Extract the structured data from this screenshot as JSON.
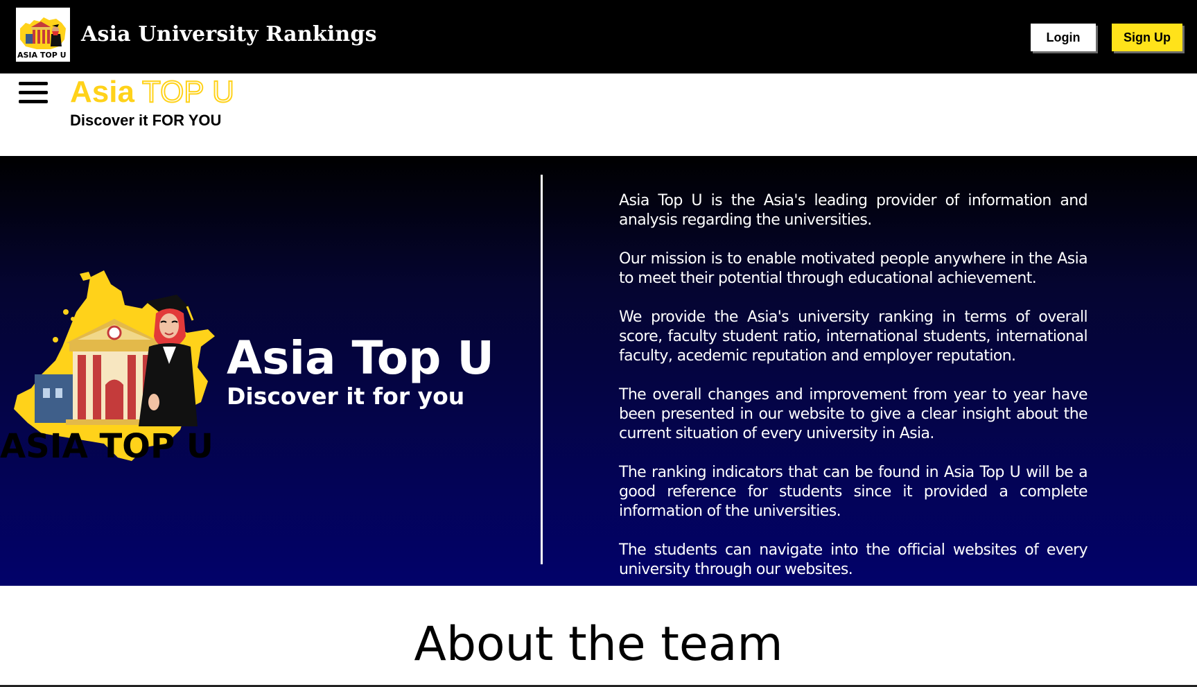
{
  "header": {
    "logo_text": "ASIA TOP U",
    "site_title": "Asia University Rankings",
    "login_label": "Login",
    "signup_label": "Sign Up"
  },
  "brand": {
    "asia": "Asia",
    "top_u": "TOP U",
    "tagline": "Discover it FOR YOU"
  },
  "hero": {
    "logo_text": "ASIA TOP U",
    "title": "Asia Top U",
    "subtitle": "Discover it for you",
    "paragraphs": [
      "Asia Top U is the Asia's leading provider of information and analysis regarding the universities.",
      "Our mission is to enable motivated people anywhere in the Asia to meet their potential through educational achievement.",
      "We provide the Asia's university ranking in terms of overall score, faculty student ratio, international students, international faculty, acedemic reputation and employer reputation.",
      "The overall changes and improvement from year to year have been presented in our website to give a clear insight about the current situation of every university in Asia.",
      "The ranking indicators that can be found in Asia Top U will be a good reference for students since it provided a complete information of the universities.",
      "The students can navigate into the official websites of every university through our websites."
    ]
  },
  "team": {
    "title": "About the team"
  },
  "colors": {
    "topbar_bg": "#000000",
    "accent_yellow": "#ffd21a",
    "signup_yellow": "#ffe21a",
    "hero_gradient_end": "#02026a"
  },
  "icons": {
    "menu": "hamburger-menu-icon",
    "logo": "asia-top-u-logo"
  }
}
